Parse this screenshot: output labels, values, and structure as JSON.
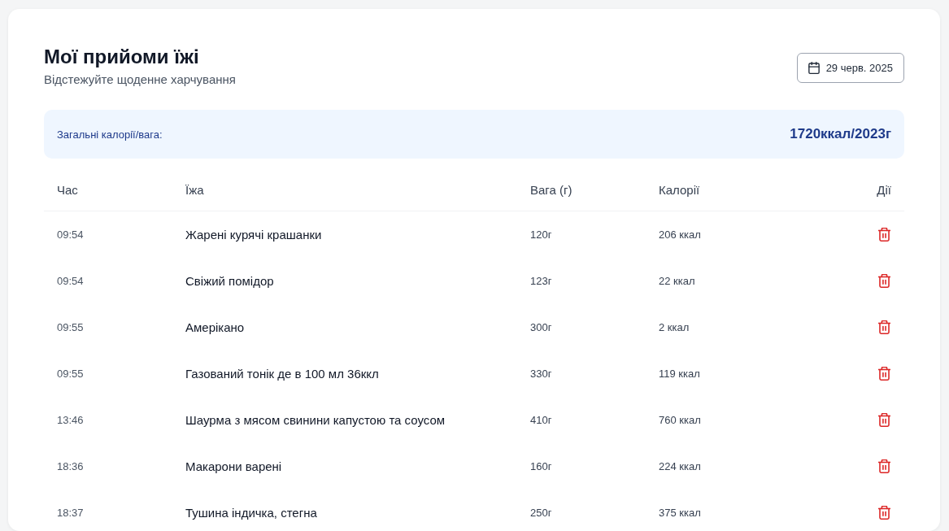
{
  "header": {
    "title": "Мої прийоми їжі",
    "subtitle": "Відстежуйте щоденне харчування",
    "date_button": "29 черв. 2025"
  },
  "summary": {
    "label": "Загальні калорії/вага:",
    "value": "1720ккал/2023г"
  },
  "table": {
    "columns": [
      "Час",
      "Їжа",
      "Вага (г)",
      "Калорії",
      "Дії"
    ],
    "rows": [
      {
        "time": "09:54",
        "food": "Жарені курячі крашанки",
        "weight": "120г",
        "calories": "206 ккал"
      },
      {
        "time": "09:54",
        "food": "Свіжий помідор",
        "weight": "123г",
        "calories": "22 ккал"
      },
      {
        "time": "09:55",
        "food": "Амерікано",
        "weight": "300г",
        "calories": "2 ккал"
      },
      {
        "time": "09:55",
        "food": "Газований тонік де в 100 мл 36ккл",
        "weight": "330г",
        "calories": "119 ккал"
      },
      {
        "time": "13:46",
        "food": "Шаурма з мясом свинини капустою та соусом",
        "weight": "410г",
        "calories": "760 ккал"
      },
      {
        "time": "18:36",
        "food": "Макарони варені",
        "weight": "160г",
        "calories": "224 ккал"
      },
      {
        "time": "18:37",
        "food": "Тушина індичка, стегна",
        "weight": "250г",
        "calories": "375 ккал"
      }
    ]
  }
}
